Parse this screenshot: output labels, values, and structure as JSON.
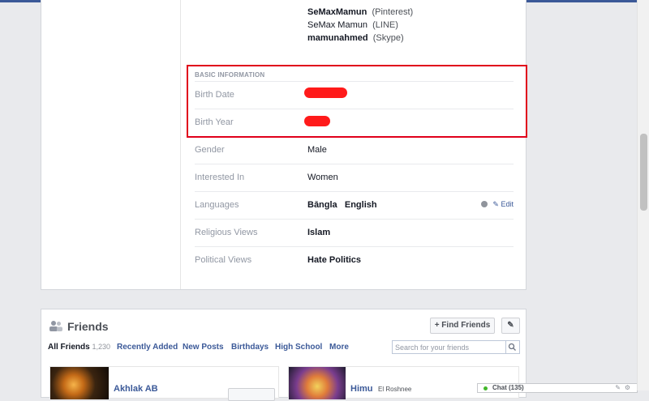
{
  "contacts": [
    {
      "name": "SeMaxMamun",
      "service": "(Pinterest)",
      "bold": true
    },
    {
      "name": "SeMax Mamun",
      "service": "(LINE)",
      "bold": false
    },
    {
      "name": "mamunahmed",
      "service": "(Skype)",
      "bold": true
    }
  ],
  "basic_info": {
    "heading": "BASIC INFORMATION",
    "birth_date_label": "Birth Date",
    "birth_year_label": "Birth Year",
    "gender_label": "Gender",
    "gender_value": "Male",
    "interested_label": "Interested In",
    "interested_value": "Women",
    "languages_label": "Languages",
    "languages_value_1": "Bāngla",
    "languages_value_2": "English",
    "edit_label": "Edit",
    "religious_label": "Religious Views",
    "religious_value": "Islam",
    "political_label": "Political Views",
    "political_value": "Hate Politics"
  },
  "friends": {
    "title": "Friends",
    "find_friends_label": "+ Find Friends",
    "tabs": {
      "all": "All Friends",
      "all_count": "1,230",
      "recent": "Recently Added",
      "new_posts": "New Posts",
      "birthdays": "Birthdays",
      "high_school": "High School",
      "more": "More"
    },
    "search_placeholder": "Search for your friends",
    "tiles": [
      {
        "name": "Akhlak AB",
        "sub": ""
      },
      {
        "name": "Himu",
        "sub": "El Roshnee"
      }
    ]
  },
  "chat": {
    "label": "Chat (135)"
  },
  "colors": {
    "brand": "#3b5998",
    "highlight": "#e0001b",
    "redaction": "#ff1a1a"
  },
  "icons": [
    "friends-icon",
    "pencil-icon",
    "globe-icon",
    "search-icon",
    "online-dot-icon",
    "settings-icon"
  ]
}
